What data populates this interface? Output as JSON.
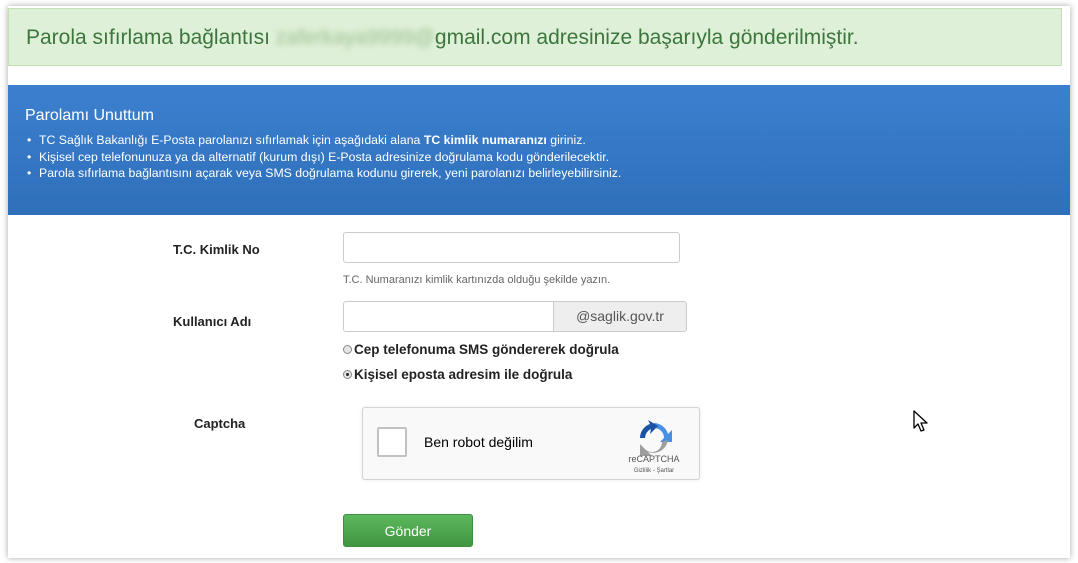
{
  "alert": {
    "prefix": "Parola sıfırlama bağlantısı",
    "blurred_email_user": "zaferkaya9999@",
    "suffix": "gmail.com adresinize başarıyla gönderilmiştir."
  },
  "panel": {
    "title": "Parolamı Unuttum",
    "bullet1_pre": "TC Sağlık Bakanlığı E-Posta parolanızı sıfırlamak için aşağıdaki alana ",
    "bullet1_bold": "TC kimlik numaranızı",
    "bullet1_post": " giriniz.",
    "bullet2": "Kişisel cep telefonunuza ya da alternatif (kurum dışı) E-Posta adresinize doğrulama kodu gönderilecektir.",
    "bullet3": "Parola sıfırlama bağlantısını açarak veya SMS doğrulama kodunu girerek, yeni parolanızı belirleyebilirsiniz."
  },
  "form": {
    "tc_label": "T.C. Kimlik No",
    "tc_value": "",
    "tc_help": "T.C. Numaranızı kimlik kartınızda olduğu şekilde yazın.",
    "user_label": "Kullanıcı Adı",
    "user_value": "",
    "domain_addon": "@saglik.gov.tr",
    "radio_sms": "Cep telefonuma SMS göndererek doğrula",
    "radio_email": "Kişisel eposta adresim ile doğrula",
    "selected_method": "email",
    "captcha_label": "Captcha",
    "captcha_text": "Ben robot değilim",
    "captcha_brand": "reCAPTCHA",
    "captcha_links": "Gizlilik - Şartlar",
    "submit_label": "Gönder"
  },
  "colors": {
    "alert_bg": "#dff0d8",
    "alert_text": "#3c763d",
    "panel_bg": "#3478c6",
    "button_bg": "#5cb85c"
  }
}
